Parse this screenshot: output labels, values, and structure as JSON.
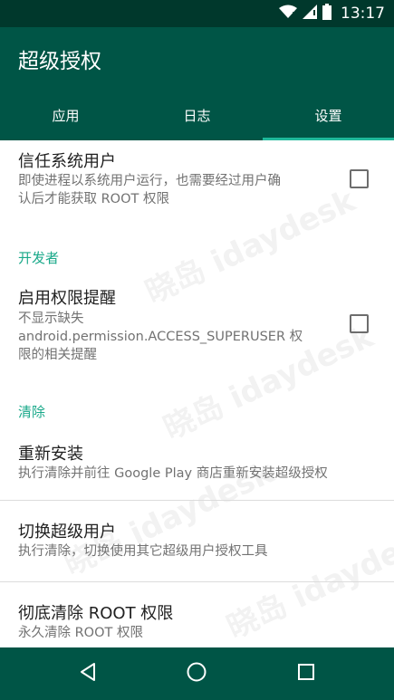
{
  "status_bar": {
    "time": "13:17",
    "icons": [
      "wifi-icon",
      "signal-icon",
      "battery-icon"
    ]
  },
  "app_bar": {
    "title": "超级授权"
  },
  "tabs": [
    {
      "label": "应用",
      "active": false
    },
    {
      "label": "日志",
      "active": false
    },
    {
      "label": "设置",
      "active": true
    }
  ],
  "settings": {
    "trust_system_user": {
      "title": "信任系统用户",
      "summary_line1": "即使进程以系统用户运行，也需要经过用户确",
      "summary_line2": "认后才能获取 ROOT 权限",
      "checked": false
    },
    "developer_category": "开发者",
    "permission_reminder": {
      "title": "启用权限提醒",
      "summary_line1": "不显示缺失",
      "summary_line2": "android.permission.ACCESS_SUPERUSER 权",
      "summary_line3": "限的相关提醒",
      "checked": false
    },
    "clear_category": "清除",
    "reinstall": {
      "title": "重新安装",
      "summary": "执行清除并前往 Google Play 商店重新安装超级授权"
    },
    "switch_superuser": {
      "title": "切换超级用户",
      "summary": "执行清除，切换使用其它超级用户授权工具"
    },
    "full_unroot": {
      "title": "彻底清除 ROOT 权限",
      "summary": "永久清除 ROOT 权限"
    }
  },
  "nav_bar": {
    "icons": [
      "back-icon",
      "home-icon",
      "recents-icon"
    ]
  },
  "colors": {
    "primary": "#005546",
    "primary_dark": "#00382c",
    "accent": "#1aa98a"
  }
}
